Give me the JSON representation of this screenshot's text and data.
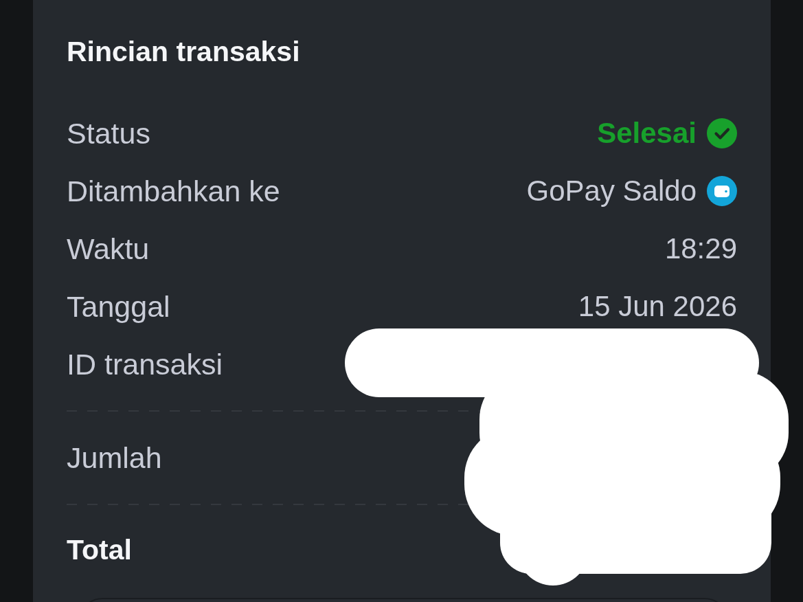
{
  "title": "Rincian transaksi",
  "details": [
    {
      "label": "Status",
      "value": "Selesai",
      "kind": "status"
    },
    {
      "label": "Ditambahkan ke",
      "value": "GoPay Saldo",
      "kind": "wallet"
    },
    {
      "label": "Waktu",
      "value": "18:29",
      "kind": "plain"
    },
    {
      "label": "Tanggal",
      "value": "15 Jun 2026",
      "kind": "plain"
    },
    {
      "label": "ID transaksi"
    }
  ],
  "amount": {
    "label": "Jumlah"
  },
  "total": {
    "label": "Total"
  }
}
